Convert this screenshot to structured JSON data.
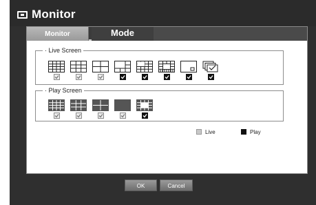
{
  "window": {
    "title": "Monitor",
    "title_icon": "monitor-icon"
  },
  "tabs": [
    {
      "label": "Monitor",
      "active": false
    },
    {
      "label": "Mode",
      "active": true
    }
  ],
  "live_screen": {
    "label": "Live Screen",
    "layouts": [
      {
        "name": "split-16-icon",
        "checked": false
      },
      {
        "name": "split-9-icon",
        "checked": false
      },
      {
        "name": "split-4-icon",
        "checked": false
      },
      {
        "name": "split-6-icon",
        "checked": true
      },
      {
        "name": "split-8-icon",
        "checked": true
      },
      {
        "name": "split-13-icon",
        "checked": true
      },
      {
        "name": "pip-icon",
        "checked": true
      },
      {
        "name": "sequence-icon",
        "checked": true
      }
    ]
  },
  "play_screen": {
    "label": "Play Screen",
    "layouts": [
      {
        "name": "split-16-icon",
        "checked": false
      },
      {
        "name": "split-9-icon",
        "checked": false
      },
      {
        "name": "split-4-icon",
        "checked": false
      },
      {
        "name": "single-icon",
        "checked": false
      },
      {
        "name": "split-13-icon",
        "checked": true
      }
    ]
  },
  "legend": {
    "live_label": "Live",
    "play_label": "Play",
    "live_color": "#c8c8c8",
    "play_color": "#111111"
  },
  "buttons": {
    "ok_label": "OK",
    "cancel_label": "Cancel"
  }
}
